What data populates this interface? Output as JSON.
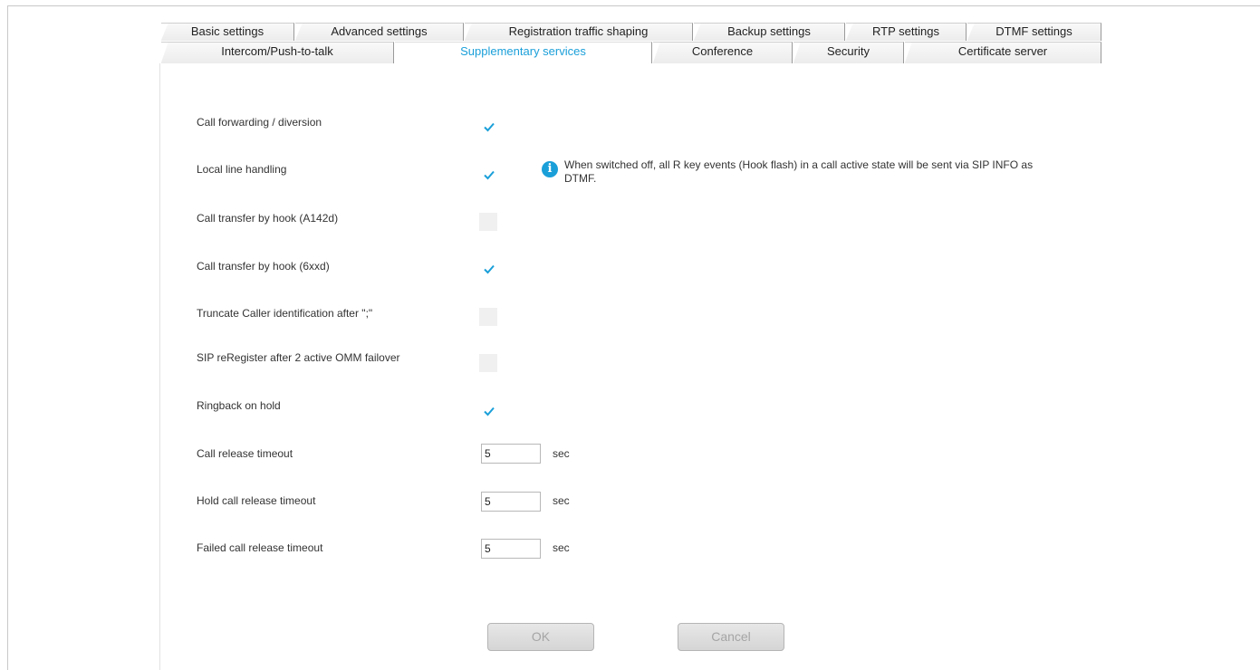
{
  "tabs": {
    "row1": [
      "Basic settings",
      "Advanced settings",
      "Registration traffic shaping",
      "Backup settings",
      "RTP settings",
      "DTMF settings"
    ],
    "row2": [
      "Intercom/Push-to-talk",
      "Supplementary services",
      "Conference",
      "Security",
      "Certificate server"
    ],
    "active": "Supplementary services"
  },
  "settings": {
    "call_forwarding": {
      "label": "Call forwarding / diversion",
      "checked": true
    },
    "local_line_handling": {
      "label": "Local line handling",
      "checked": true
    },
    "call_transfer_a142d": {
      "label": "Call transfer by hook (A142d)",
      "checked": false
    },
    "call_transfer_6xxd": {
      "label": "Call transfer by hook (6xxd)",
      "checked": true
    },
    "truncate_caller_id": {
      "label": "Truncate Caller identification after \";\"",
      "checked": false
    },
    "sip_reregister": {
      "label": "SIP reRegister after 2 active OMM failover",
      "checked": false
    },
    "ringback_on_hold": {
      "label": "Ringback on hold",
      "checked": true
    }
  },
  "info_note": "When switched off, all R key events (Hook flash) in a call active state will be sent via SIP INFO as DTMF.",
  "timeouts": {
    "call_release": {
      "label": "Call release timeout",
      "value": "5",
      "unit": "sec"
    },
    "hold_call_release": {
      "label": "Hold call release timeout",
      "value": "5",
      "unit": "sec"
    },
    "failed_call_release": {
      "label": "Failed call release timeout",
      "value": "5",
      "unit": "sec"
    }
  },
  "buttons": {
    "ok": "OK",
    "cancel": "Cancel"
  },
  "colors": {
    "accent": "#1a9fd9",
    "disabled_text": "#a5a5a5"
  }
}
